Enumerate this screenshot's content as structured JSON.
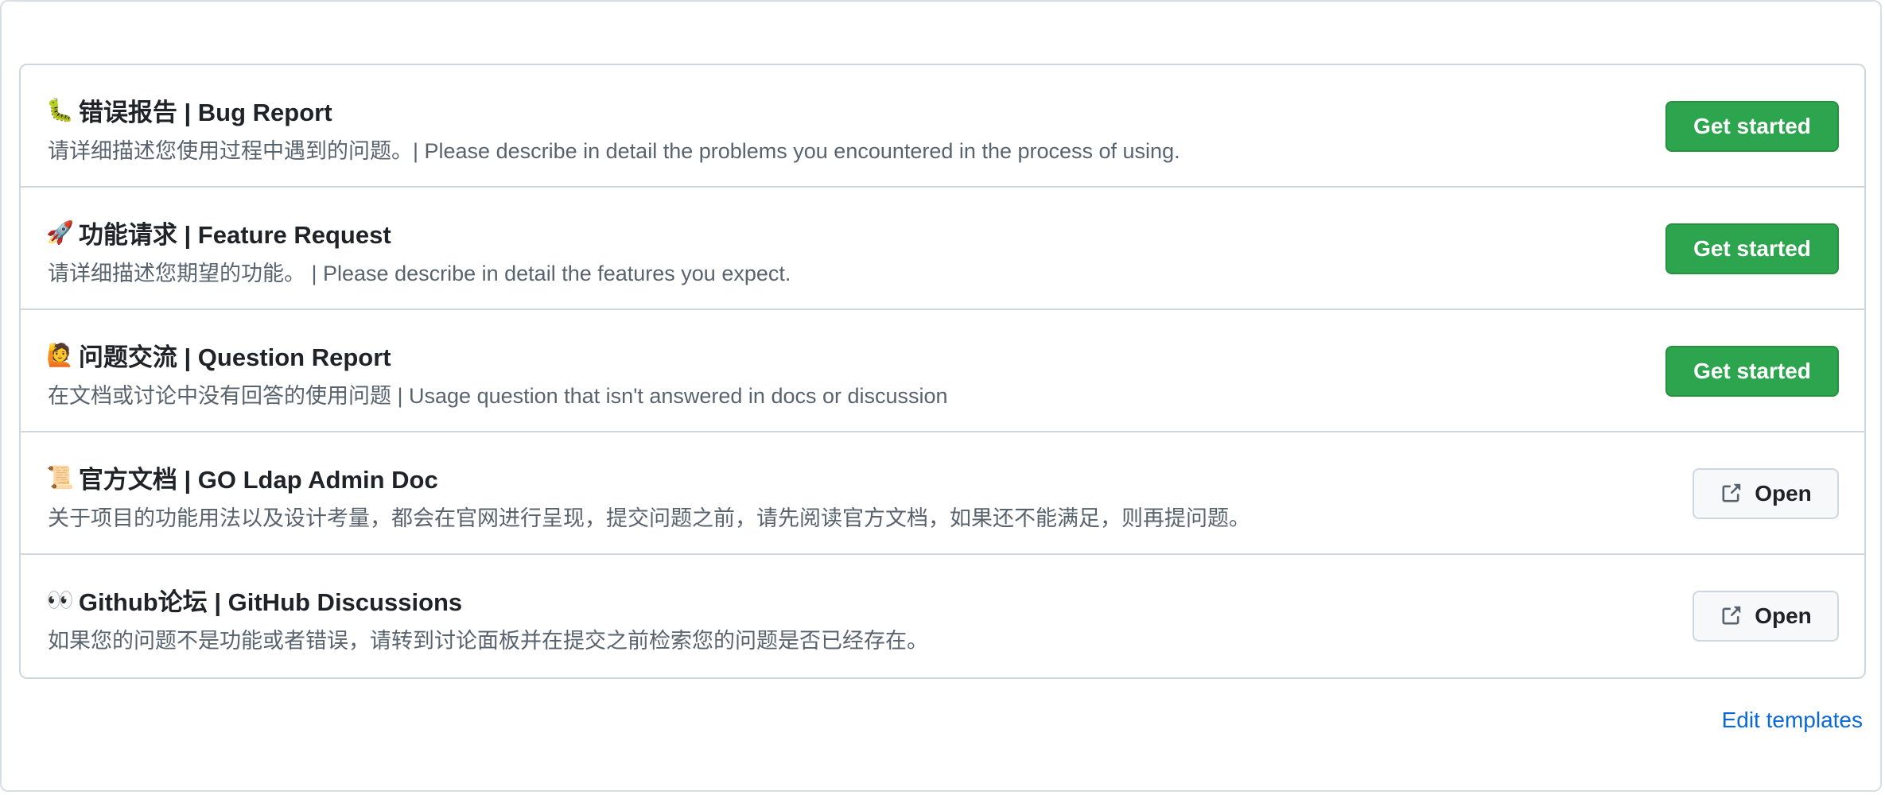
{
  "templates": [
    {
      "emoji": "🐛",
      "title": "错误报告 | Bug Report",
      "description": "请详细描述您使用过程中遇到的问题。| Please describe in detail the problems you encountered in the process of using.",
      "button_label": "Get started",
      "button_type": "primary"
    },
    {
      "emoji": "🚀",
      "title": "功能请求 | Feature Request",
      "description": "请详细描述您期望的功能。 | Please describe in detail the features you expect.",
      "button_label": "Get started",
      "button_type": "primary"
    },
    {
      "emoji": "🙋",
      "title": "问题交流 | Question Report",
      "description": "在文档或讨论中没有回答的使用问题 | Usage question that isn't answered in docs or discussion",
      "button_label": "Get started",
      "button_type": "primary"
    },
    {
      "emoji": "📜",
      "title": "官方文档 | GO Ldap Admin Doc",
      "description": "关于项目的功能用法以及设计考量，都会在官网进行呈现，提交问题之前，请先阅读官方文档，如果还不能满足，则再提问题。",
      "button_label": "Open",
      "button_type": "secondary"
    },
    {
      "emoji": "👀",
      "title": "Github论坛 | GitHub Discussions",
      "description": "如果您的问题不是功能或者错误，请转到讨论面板并在提交之前检索您的问题是否已经存在。",
      "button_label": "Open",
      "button_type": "secondary"
    }
  ],
  "icons": {
    "external_link": "external-link-icon"
  },
  "footer": {
    "edit_templates_label": "Edit templates"
  },
  "colors": {
    "primary_button": "#2da44e",
    "link": "#0969da",
    "border": "#d0d7de"
  }
}
